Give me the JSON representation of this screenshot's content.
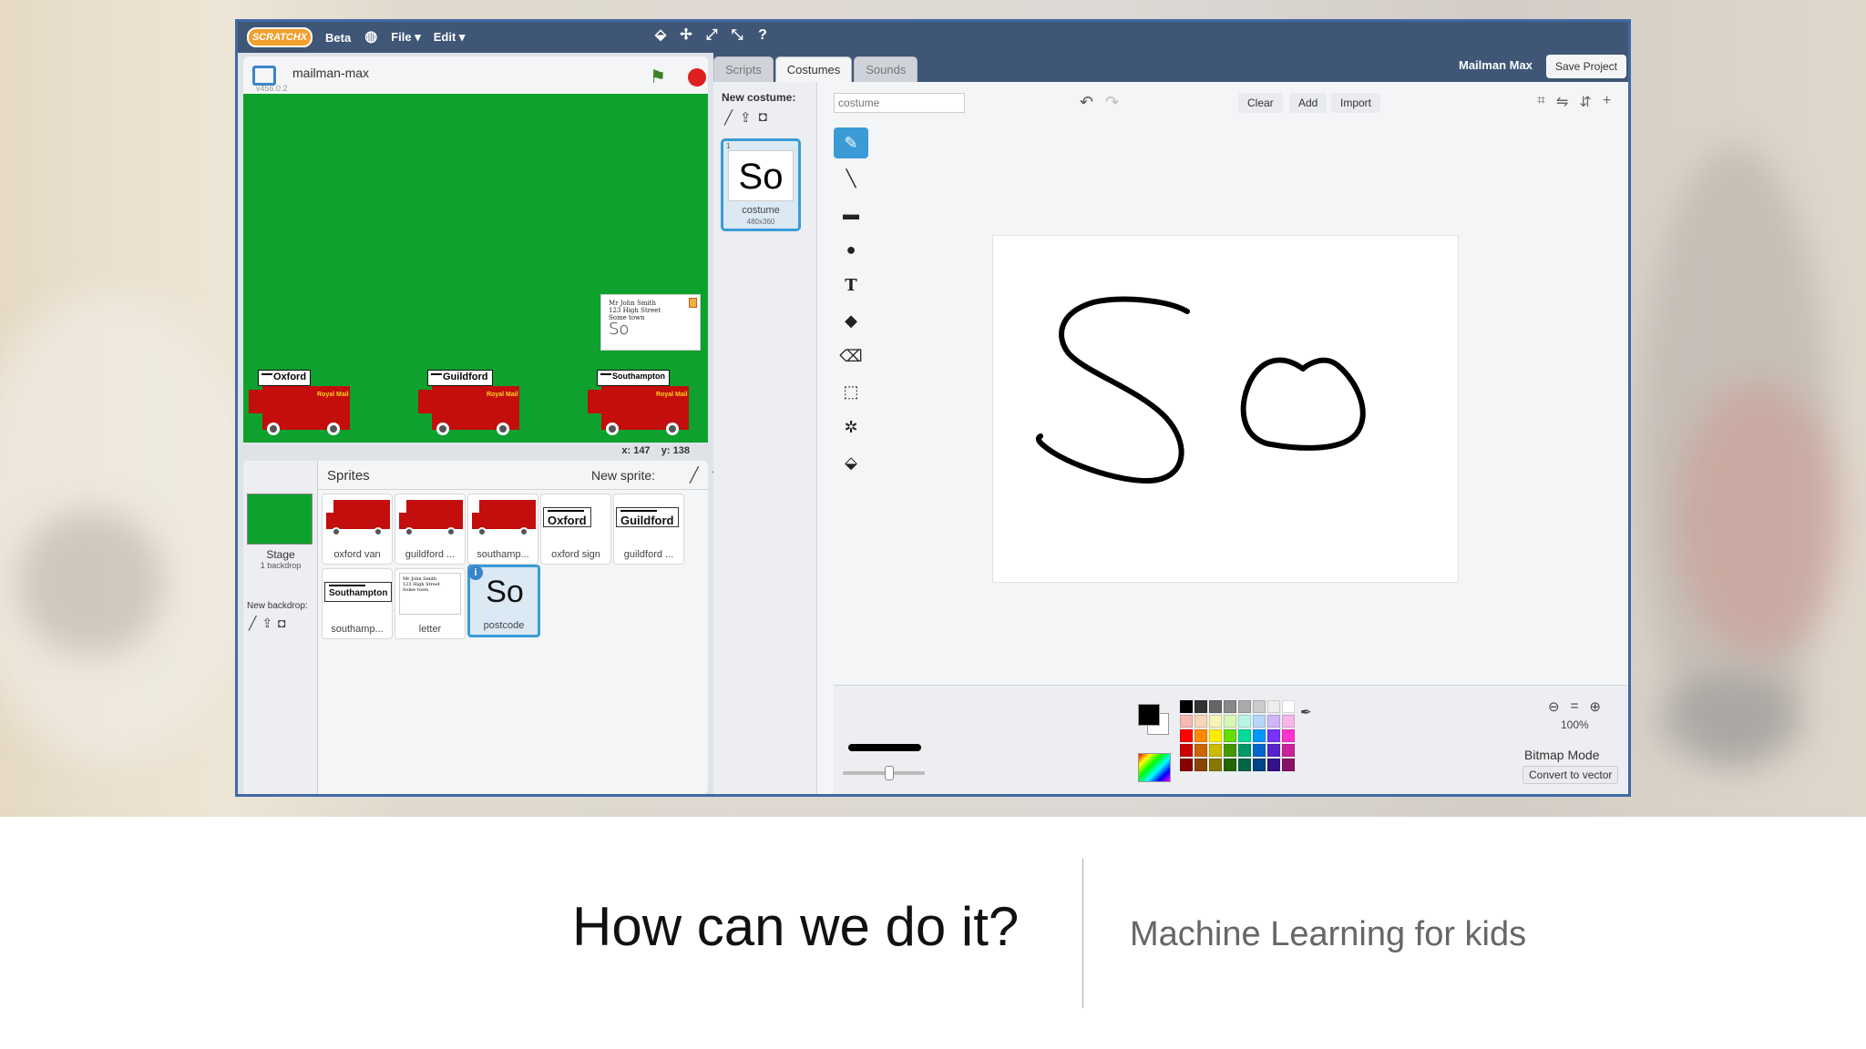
{
  "menubar": {
    "logo": "SCRATCHX",
    "beta": "Beta",
    "file": "File ▾",
    "edit": "Edit ▾"
  },
  "stage": {
    "project_name": "mailman-max",
    "version": "v456.0.2",
    "coords_x": "x: 147",
    "coords_y": "y: 138",
    "letter_lines": [
      "Mr John Smith",
      "123 High Street",
      "Some town"
    ],
    "letter_postcode": "So",
    "vans": [
      {
        "sign": "Oxford",
        "brand": "Royal Mail"
      },
      {
        "sign": "Guildford",
        "brand": "Royal Mail"
      },
      {
        "sign": "Southampton",
        "brand": "Royal Mail"
      }
    ]
  },
  "sprites": {
    "title": "Sprites",
    "new_sprite": "New sprite:",
    "stage_label": "Stage",
    "stage_sub": "1 backdrop",
    "new_backdrop": "New backdrop:",
    "items": [
      {
        "label": "oxford van"
      },
      {
        "label": "guildford ..."
      },
      {
        "label": "southamp..."
      },
      {
        "label": "oxford sign",
        "sign": "Oxford"
      },
      {
        "label": "guildford ...",
        "sign": "Guildford"
      },
      {
        "label": "southamp...",
        "sign": "Southampton"
      },
      {
        "label": "letter"
      },
      {
        "label": "postcode",
        "text": "So"
      }
    ]
  },
  "tabs": [
    {
      "label": "Scripts"
    },
    {
      "label": "Costumes"
    },
    {
      "label": "Sounds"
    }
  ],
  "header": {
    "user": "Mailman Max",
    "save": "Save Project"
  },
  "costumes": {
    "new_costume": "New costume:",
    "item_number": "1",
    "item_name": "costume",
    "item_size": "480x360",
    "item_text": "So"
  },
  "editor": {
    "name_placeholder": "costume",
    "clear": "Clear",
    "add": "Add",
    "import": "Import",
    "zoom": "100%",
    "mode": "Bitmap Mode",
    "convert": "Convert to vector",
    "palette": [
      "#000000",
      "#333333",
      "#666666",
      "#888888",
      "#aaaaaa",
      "#cccccc",
      "#eeeeee",
      "#ffffff",
      "#f7b7b7",
      "#f7d6b7",
      "#f7f2b7",
      "#d7f7b7",
      "#b7f7e3",
      "#b7d7f7",
      "#cfb7f7",
      "#f7b7ea",
      "#ff0000",
      "#ff8800",
      "#ffee00",
      "#66dd00",
      "#00dd99",
      "#0099ff",
      "#7733ff",
      "#ff33cc",
      "#cc0000",
      "#cc6600",
      "#ccbb00",
      "#449900",
      "#009966",
      "#0066cc",
      "#5522cc",
      "#cc2299",
      "#880000",
      "#884400",
      "#887700",
      "#226600",
      "#006644",
      "#004488",
      "#331188",
      "#881166"
    ]
  },
  "caption": {
    "title": "How can we do it?",
    "subtitle": "Machine Learning for kids"
  }
}
